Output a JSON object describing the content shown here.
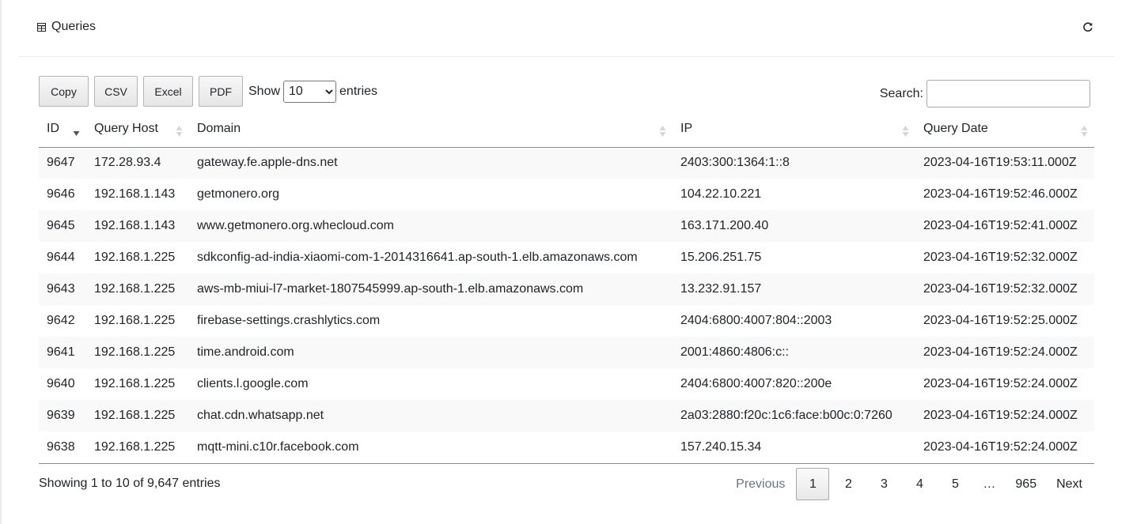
{
  "panel": {
    "title": "Queries",
    "title_icon": "table-icon",
    "refresh_icon": "refresh-icon"
  },
  "toolbar": {
    "buttons": [
      "Copy",
      "CSV",
      "Excel",
      "PDF"
    ],
    "length_prefix": "Show",
    "length_value": "10",
    "length_suffix": "entries",
    "search_label": "Search:",
    "search_value": ""
  },
  "table": {
    "headers": [
      "ID",
      "Query Host",
      "Domain",
      "IP",
      "Query Date"
    ],
    "sorted_column": "ID",
    "sort_direction": "descending",
    "rows": [
      [
        "9647",
        "172.28.93.4",
        "gateway.fe.apple-dns.net",
        "2403:300:1364:1::8",
        "2023-04-16T19:53:11.000Z"
      ],
      [
        "9646",
        "192.168.1.143",
        "getmonero.org",
        "104.22.10.221",
        "2023-04-16T19:52:46.000Z"
      ],
      [
        "9645",
        "192.168.1.143",
        "www.getmonero.org.whecloud.com",
        "163.171.200.40",
        "2023-04-16T19:52:41.000Z"
      ],
      [
        "9644",
        "192.168.1.225",
        "sdkconfig-ad-india-xiaomi-com-1-2014316641.ap-south-1.elb.amazonaws.com",
        "15.206.251.75",
        "2023-04-16T19:52:32.000Z"
      ],
      [
        "9643",
        "192.168.1.225",
        "aws-mb-miui-l7-market-1807545999.ap-south-1.elb.amazonaws.com",
        "13.232.91.157",
        "2023-04-16T19:52:32.000Z"
      ],
      [
        "9642",
        "192.168.1.225",
        "firebase-settings.crashlytics.com",
        "2404:6800:4007:804::2003",
        "2023-04-16T19:52:25.000Z"
      ],
      [
        "9641",
        "192.168.1.225",
        "time.android.com",
        "2001:4860:4806:c::",
        "2023-04-16T19:52:24.000Z"
      ],
      [
        "9640",
        "192.168.1.225",
        "clients.l.google.com",
        "2404:6800:4007:820::200e",
        "2023-04-16T19:52:24.000Z"
      ],
      [
        "9639",
        "192.168.1.225",
        "chat.cdn.whatsapp.net",
        "2a03:2880:f20c:1c6:face:b00c:0:7260",
        "2023-04-16T19:52:24.000Z"
      ],
      [
        "9638",
        "192.168.1.225",
        "mqtt-mini.c10r.facebook.com",
        "157.240.15.34",
        "2023-04-16T19:52:24.000Z"
      ]
    ]
  },
  "footer": {
    "info": "Showing 1 to 10 of 9,647 entries",
    "pagination": {
      "previous": "Previous",
      "pages": [
        "1",
        "2",
        "3",
        "4",
        "5",
        "…",
        "965"
      ],
      "current": "1",
      "next": "Next"
    }
  }
}
